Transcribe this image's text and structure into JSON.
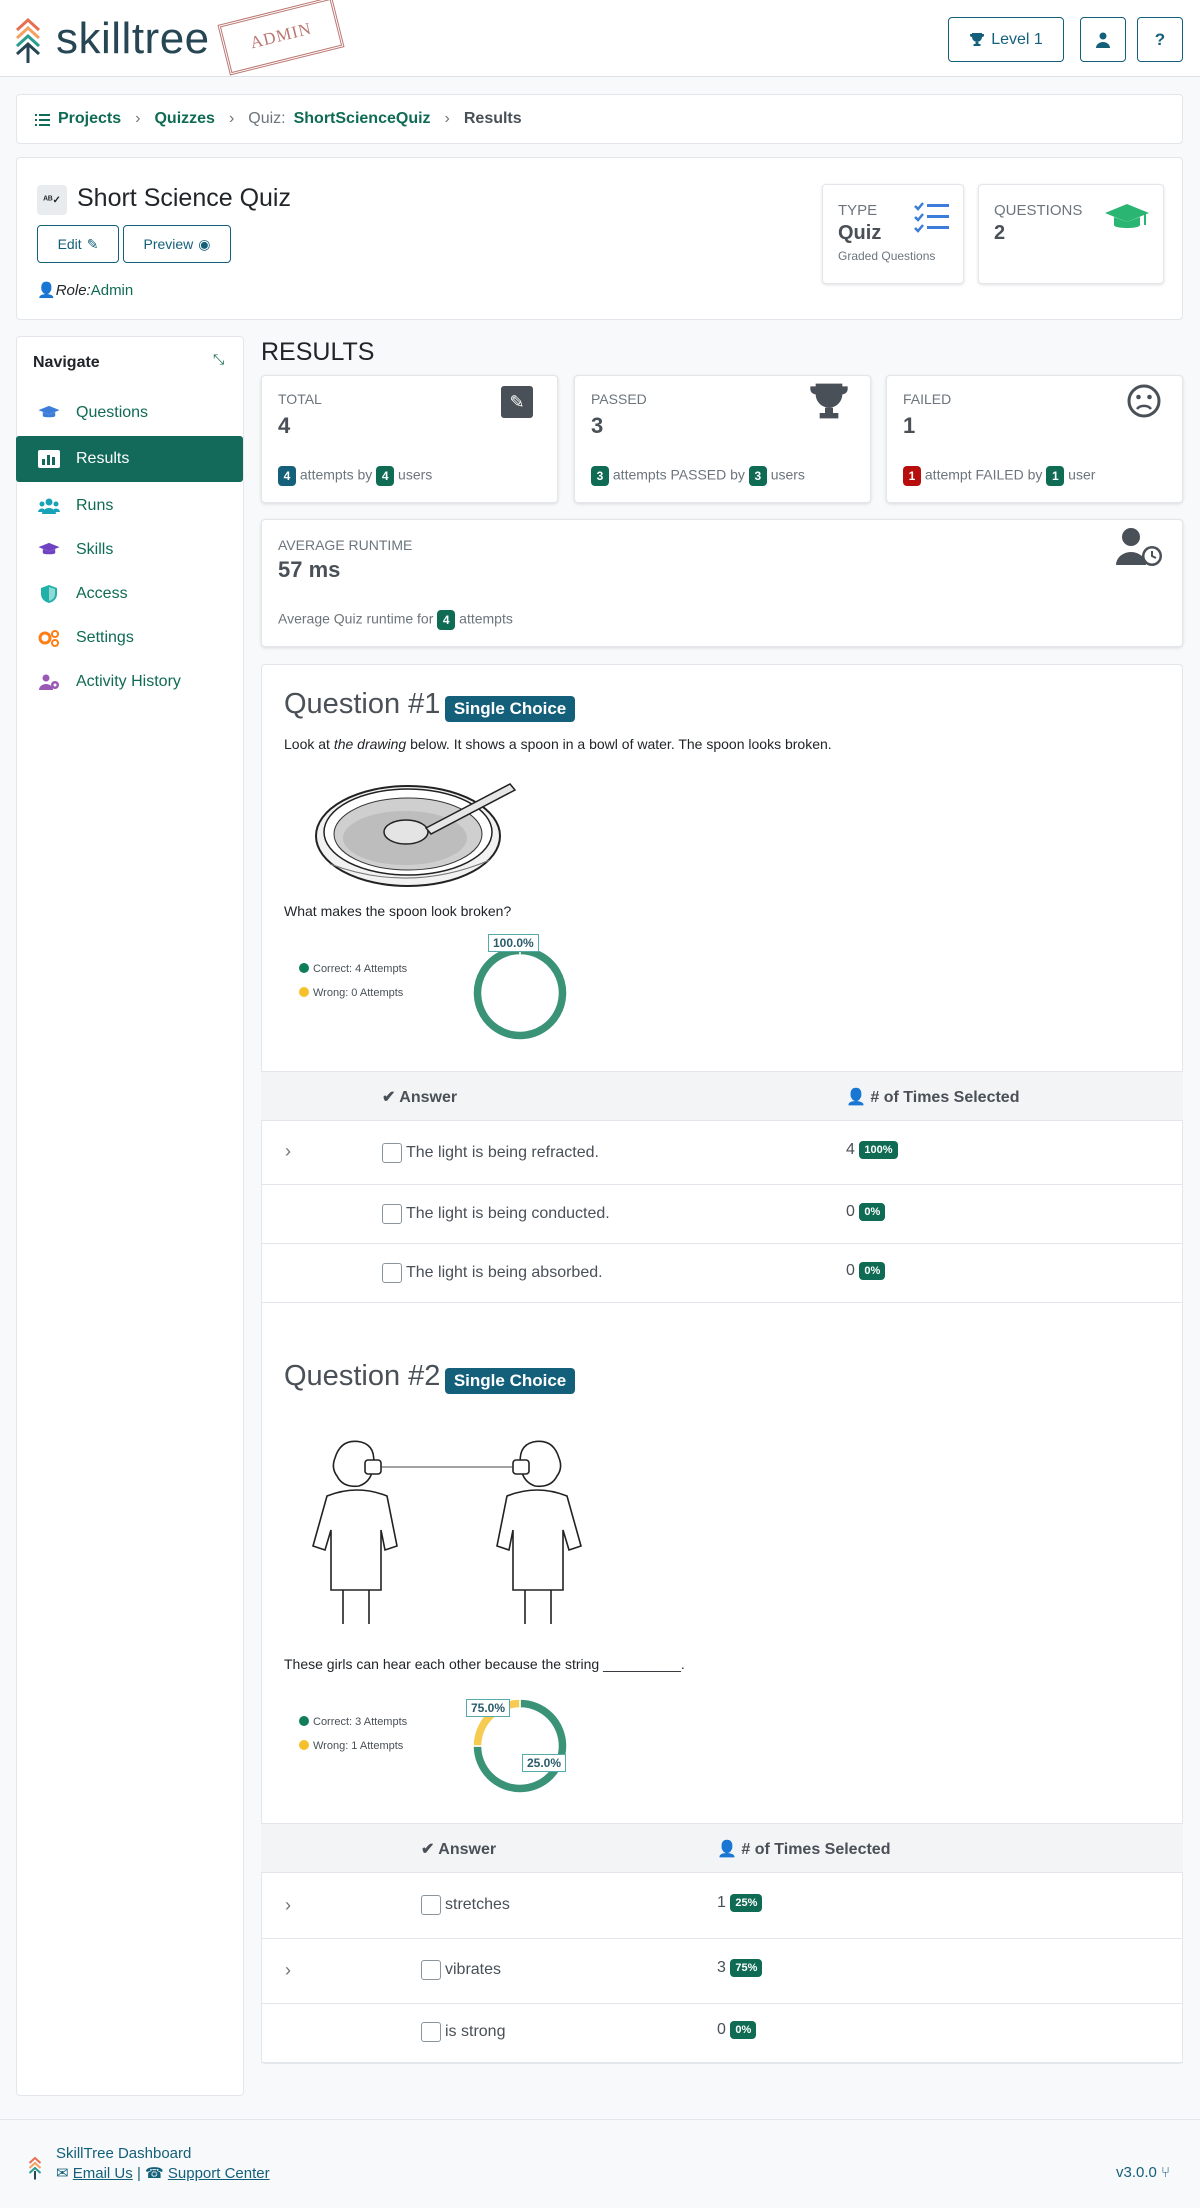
{
  "header": {
    "logo_text": "skilltree",
    "admin_stamp": "ADMIN",
    "level_label": "Level 1",
    "icons": [
      "trophy-icon",
      "user-icon",
      "question-icon"
    ]
  },
  "breadcrumb": {
    "projects": "Projects",
    "quizzes": "Quizzes",
    "quiz_prefix": "Quiz:",
    "quiz_name": "ShortScienceQuiz",
    "current": "Results"
  },
  "quiz": {
    "title": "Short Science Quiz",
    "edit_label": "Edit",
    "preview_label": "Preview",
    "role_label": "Role:",
    "role_value": "Admin",
    "type_label": "TYPE",
    "type_value": "Quiz",
    "type_sub": "Graded Questions",
    "questions_label": "QUESTIONS",
    "questions_value": "2"
  },
  "nav": {
    "title": "Navigate",
    "items": [
      {
        "label": "Questions",
        "icon": "graduation-cap-icon",
        "color": "#3b7dd8"
      },
      {
        "label": "Results",
        "icon": "chart-icon",
        "color": "#ffffff"
      },
      {
        "label": "Runs",
        "icon": "users-icon",
        "color": "#17a2b8"
      },
      {
        "label": "Skills",
        "icon": "graduation-cap-icon",
        "color": "#6f42c1"
      },
      {
        "label": "Access",
        "icon": "shield-icon",
        "color": "#20b2aa"
      },
      {
        "label": "Settings",
        "icon": "cogs-icon",
        "color": "#fd7e14"
      },
      {
        "label": "Activity History",
        "icon": "users-cog-icon",
        "color": "#9b59b6"
      }
    ]
  },
  "results": {
    "heading": "RESULTS",
    "total": {
      "label": "TOTAL",
      "value": "4",
      "n1": "4",
      "t1": "attempts by",
      "n2": "4",
      "t2": "users"
    },
    "passed": {
      "label": "PASSED",
      "value": "3",
      "n1": "3",
      "t1": "attempts PASSED by",
      "n2": "3",
      "t2": "users"
    },
    "failed": {
      "label": "FAILED",
      "value": "1",
      "n1": "1",
      "t1": "attempt FAILED by",
      "n2": "1",
      "t2": "user"
    },
    "runtime": {
      "label": "AVERAGE RUNTIME",
      "value": "57 ms",
      "t1": "Average Quiz runtime for",
      "n1": "4",
      "t2": "attempts"
    }
  },
  "questions": [
    {
      "title": "Question #1",
      "type": "Single Choice",
      "intro_pre": "Look at ",
      "intro_em": "the drawing",
      "intro_post": " below. It shows a spoon in a bowl of water. The spoon looks broken.",
      "prompt": "What makes the spoon look broken?",
      "legend_correct": "Correct: 4 Attempts",
      "legend_wrong": "Wrong: 0 Attempts",
      "chart_correct_pct": "100.0%",
      "col_answer": "Answer",
      "col_times": "# of Times Selected",
      "answers": [
        {
          "text": "The light is being refracted.",
          "count": "4",
          "pct": "100%"
        },
        {
          "text": "The light is being conducted.",
          "count": "0",
          "pct": "0%"
        },
        {
          "text": "The light is being absorbed.",
          "count": "0",
          "pct": "0%"
        }
      ]
    },
    {
      "title": "Question #2",
      "type": "Single Choice",
      "prompt": "These girls can hear each other because the string __________.",
      "legend_correct": "Correct: 3 Attempts",
      "legend_wrong": "Wrong: 1 Attempts",
      "chart_correct_pct": "75.0%",
      "chart_wrong_pct": "25.0%",
      "col_answer": "Answer",
      "col_times": "# of Times Selected",
      "answers": [
        {
          "text": "stretches",
          "count": "1",
          "pct": "25%"
        },
        {
          "text": "vibrates",
          "count": "3",
          "pct": "75%"
        },
        {
          "text": "is strong",
          "count": "0",
          "pct": "0%"
        }
      ]
    }
  ],
  "chart_data": [
    {
      "type": "pie",
      "categories": [
        "Correct",
        "Wrong"
      ],
      "values": [
        4,
        0
      ],
      "colors": [
        "#0f7c5a",
        "#f5c02c"
      ]
    },
    {
      "type": "pie",
      "categories": [
        "Correct",
        "Wrong"
      ],
      "values": [
        3,
        1
      ],
      "colors": [
        "#0f7c5a",
        "#f5c02c"
      ]
    }
  ],
  "footer": {
    "title": "SkillTree Dashboard",
    "email": "Email Us",
    "separator": "|",
    "support": "Support Center",
    "version": "v3.0.0"
  }
}
